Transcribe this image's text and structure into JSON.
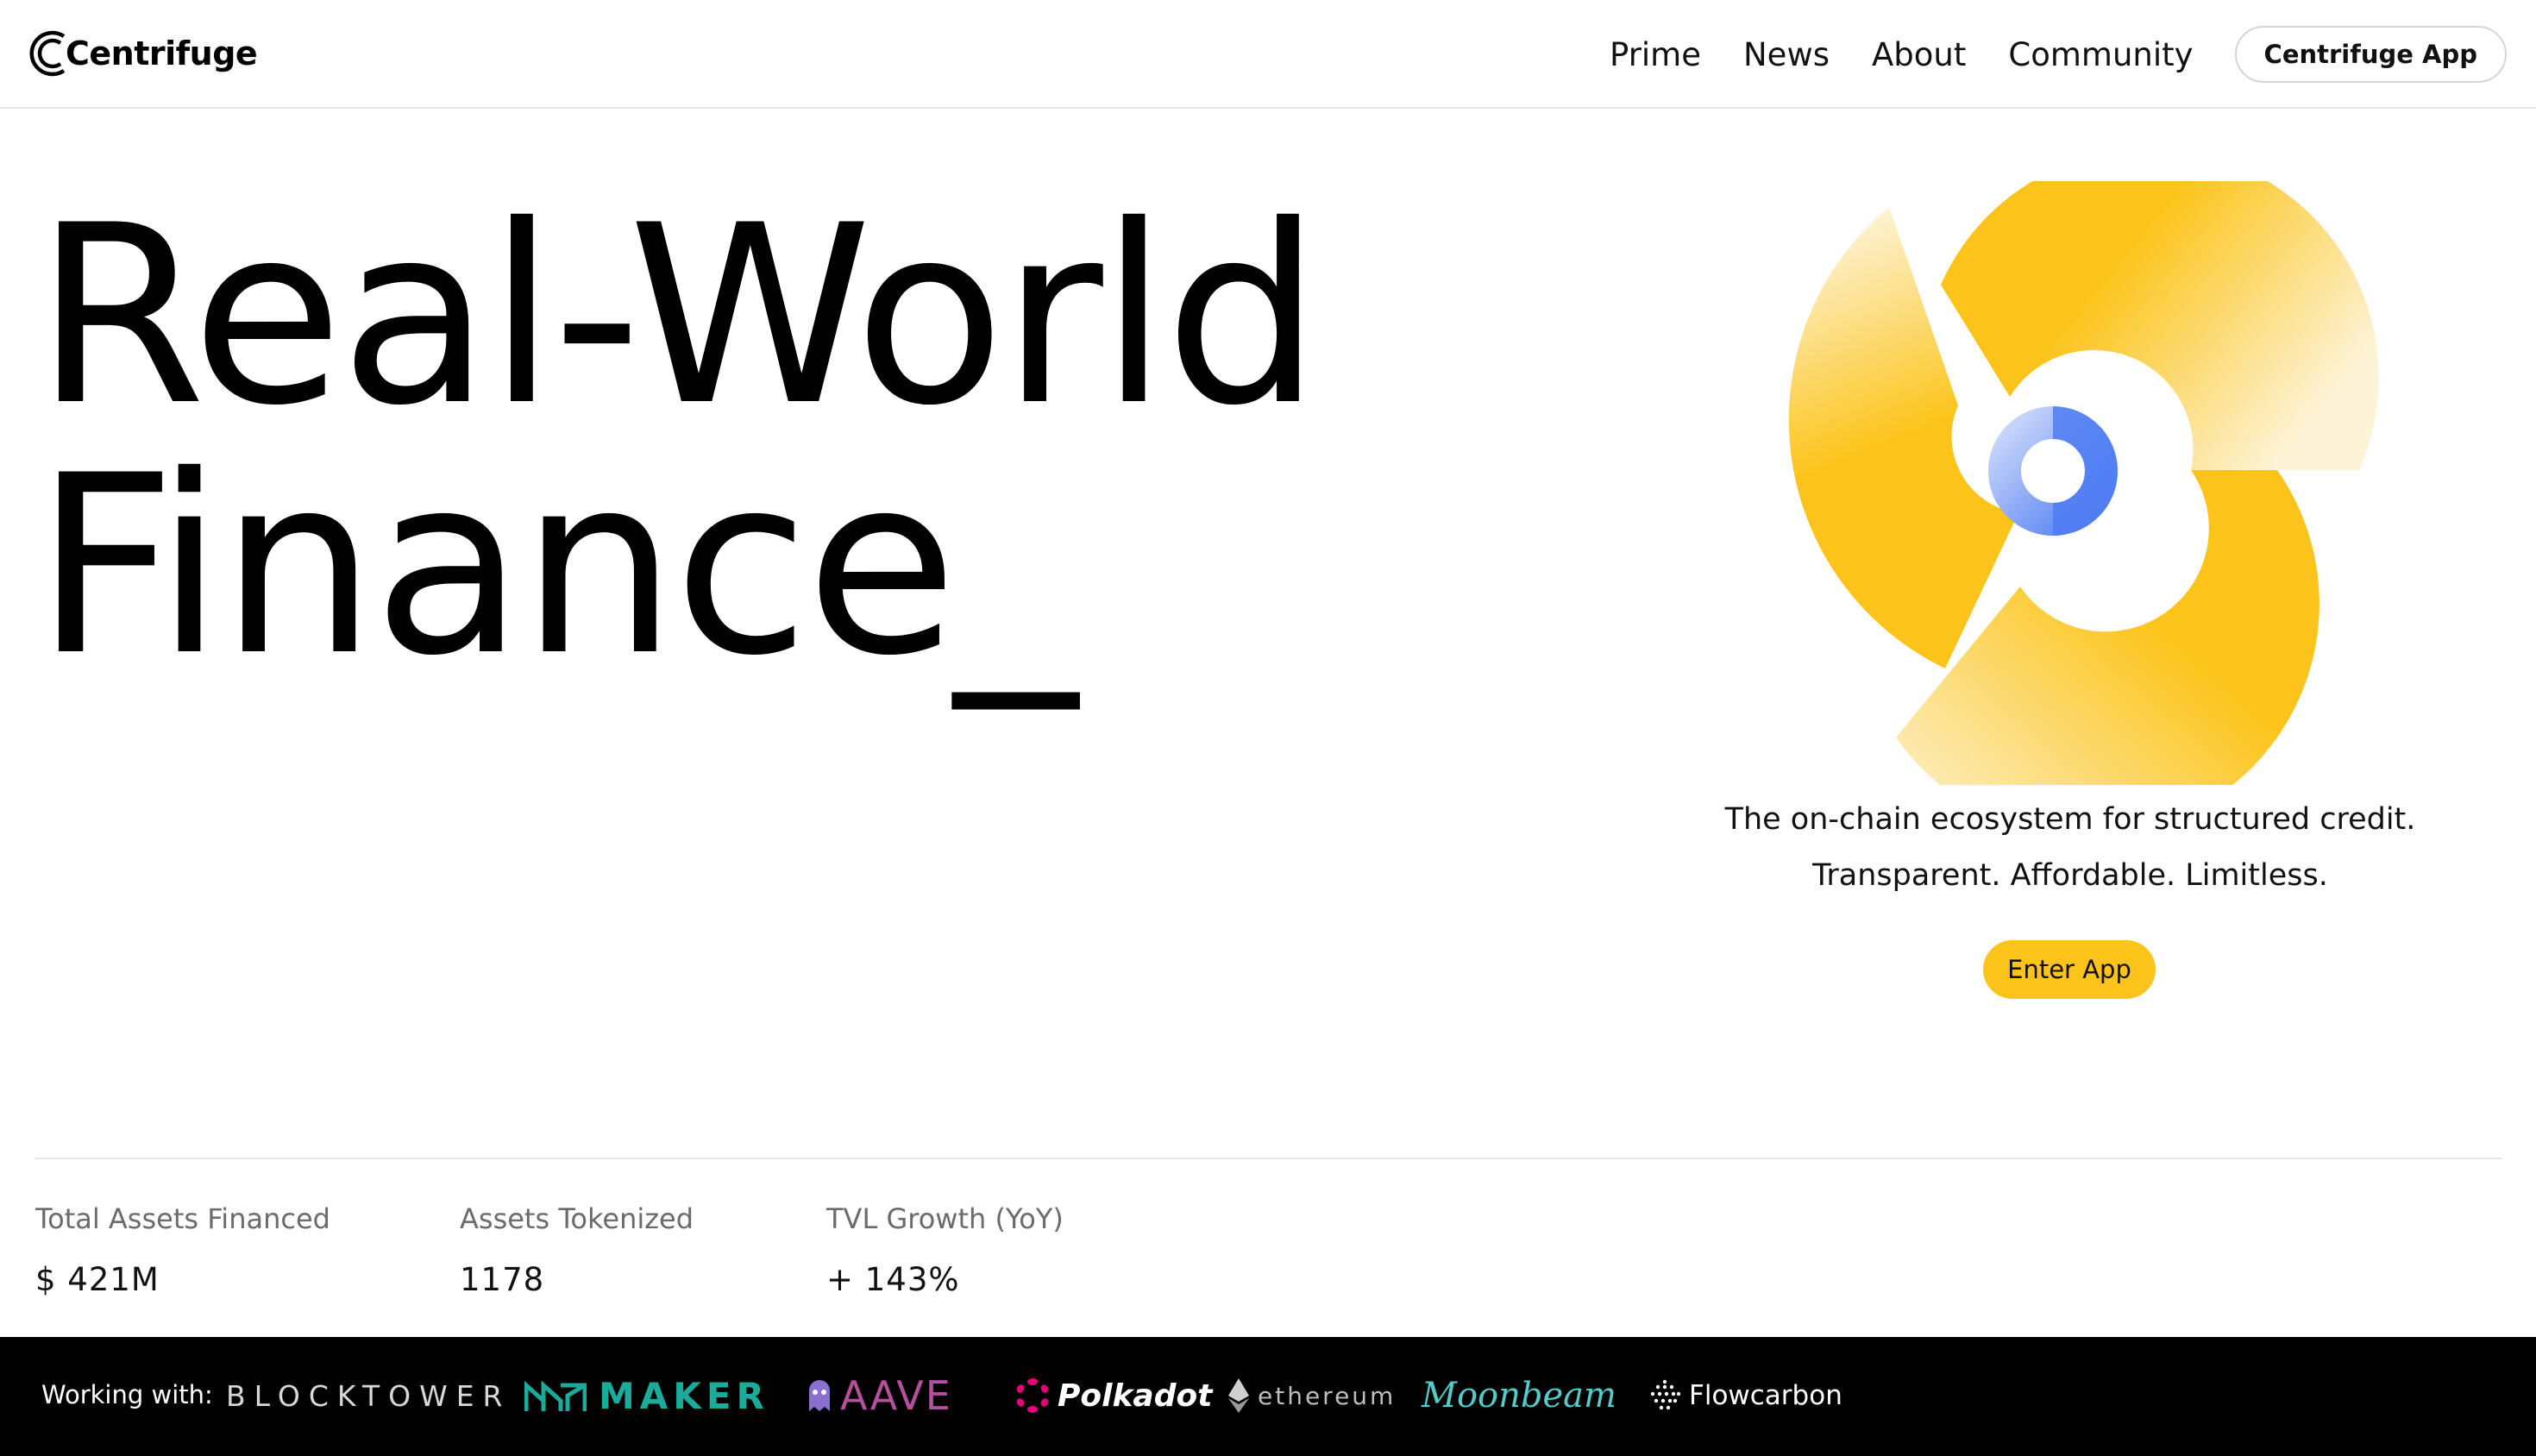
{
  "header": {
    "logo_text": "Centrifuge",
    "nav": [
      "Prime",
      "News",
      "About",
      "Community"
    ],
    "app_button": "Centrifuge App"
  },
  "hero": {
    "title_line1": "Real-World",
    "title_line2": "Finance_",
    "tagline_line1": "The on-chain ecosystem for structured credit.",
    "tagline_line2": "Transparent. Affordable. Limitless.",
    "cta": "Enter App"
  },
  "stats": [
    {
      "label": "Total Assets Financed",
      "value": "$ 421M"
    },
    {
      "label": "Assets Tokenized",
      "value": "1178"
    },
    {
      "label": "TVL Growth (YoY)",
      "value": "+ 143%"
    }
  ],
  "partners": {
    "label": "Working with:",
    "logos": [
      {
        "name": "BLOCKTOWER",
        "icon": "blocktower-logo"
      },
      {
        "name": "MAKER",
        "icon": "maker-logo",
        "color": "#1aab9b"
      },
      {
        "name": "AAVE",
        "icon": "aave-ghost-logo",
        "color": "#b6509e"
      },
      {
        "name": "Polkadot",
        "icon": "polkadot-logo",
        "color": "#e6007a"
      },
      {
        "name": "ethereum",
        "icon": "ethereum-diamond-logo"
      },
      {
        "name": "Moonbeam",
        "icon": "moonbeam-logo",
        "color": "#53cbc9"
      },
      {
        "name": "Flowcarbon",
        "icon": "flowcarbon-logo"
      }
    ]
  },
  "colors": {
    "accent_yellow": "#fcc41a",
    "accent_blue": "#4f7df2",
    "footer_bg": "#000000"
  }
}
